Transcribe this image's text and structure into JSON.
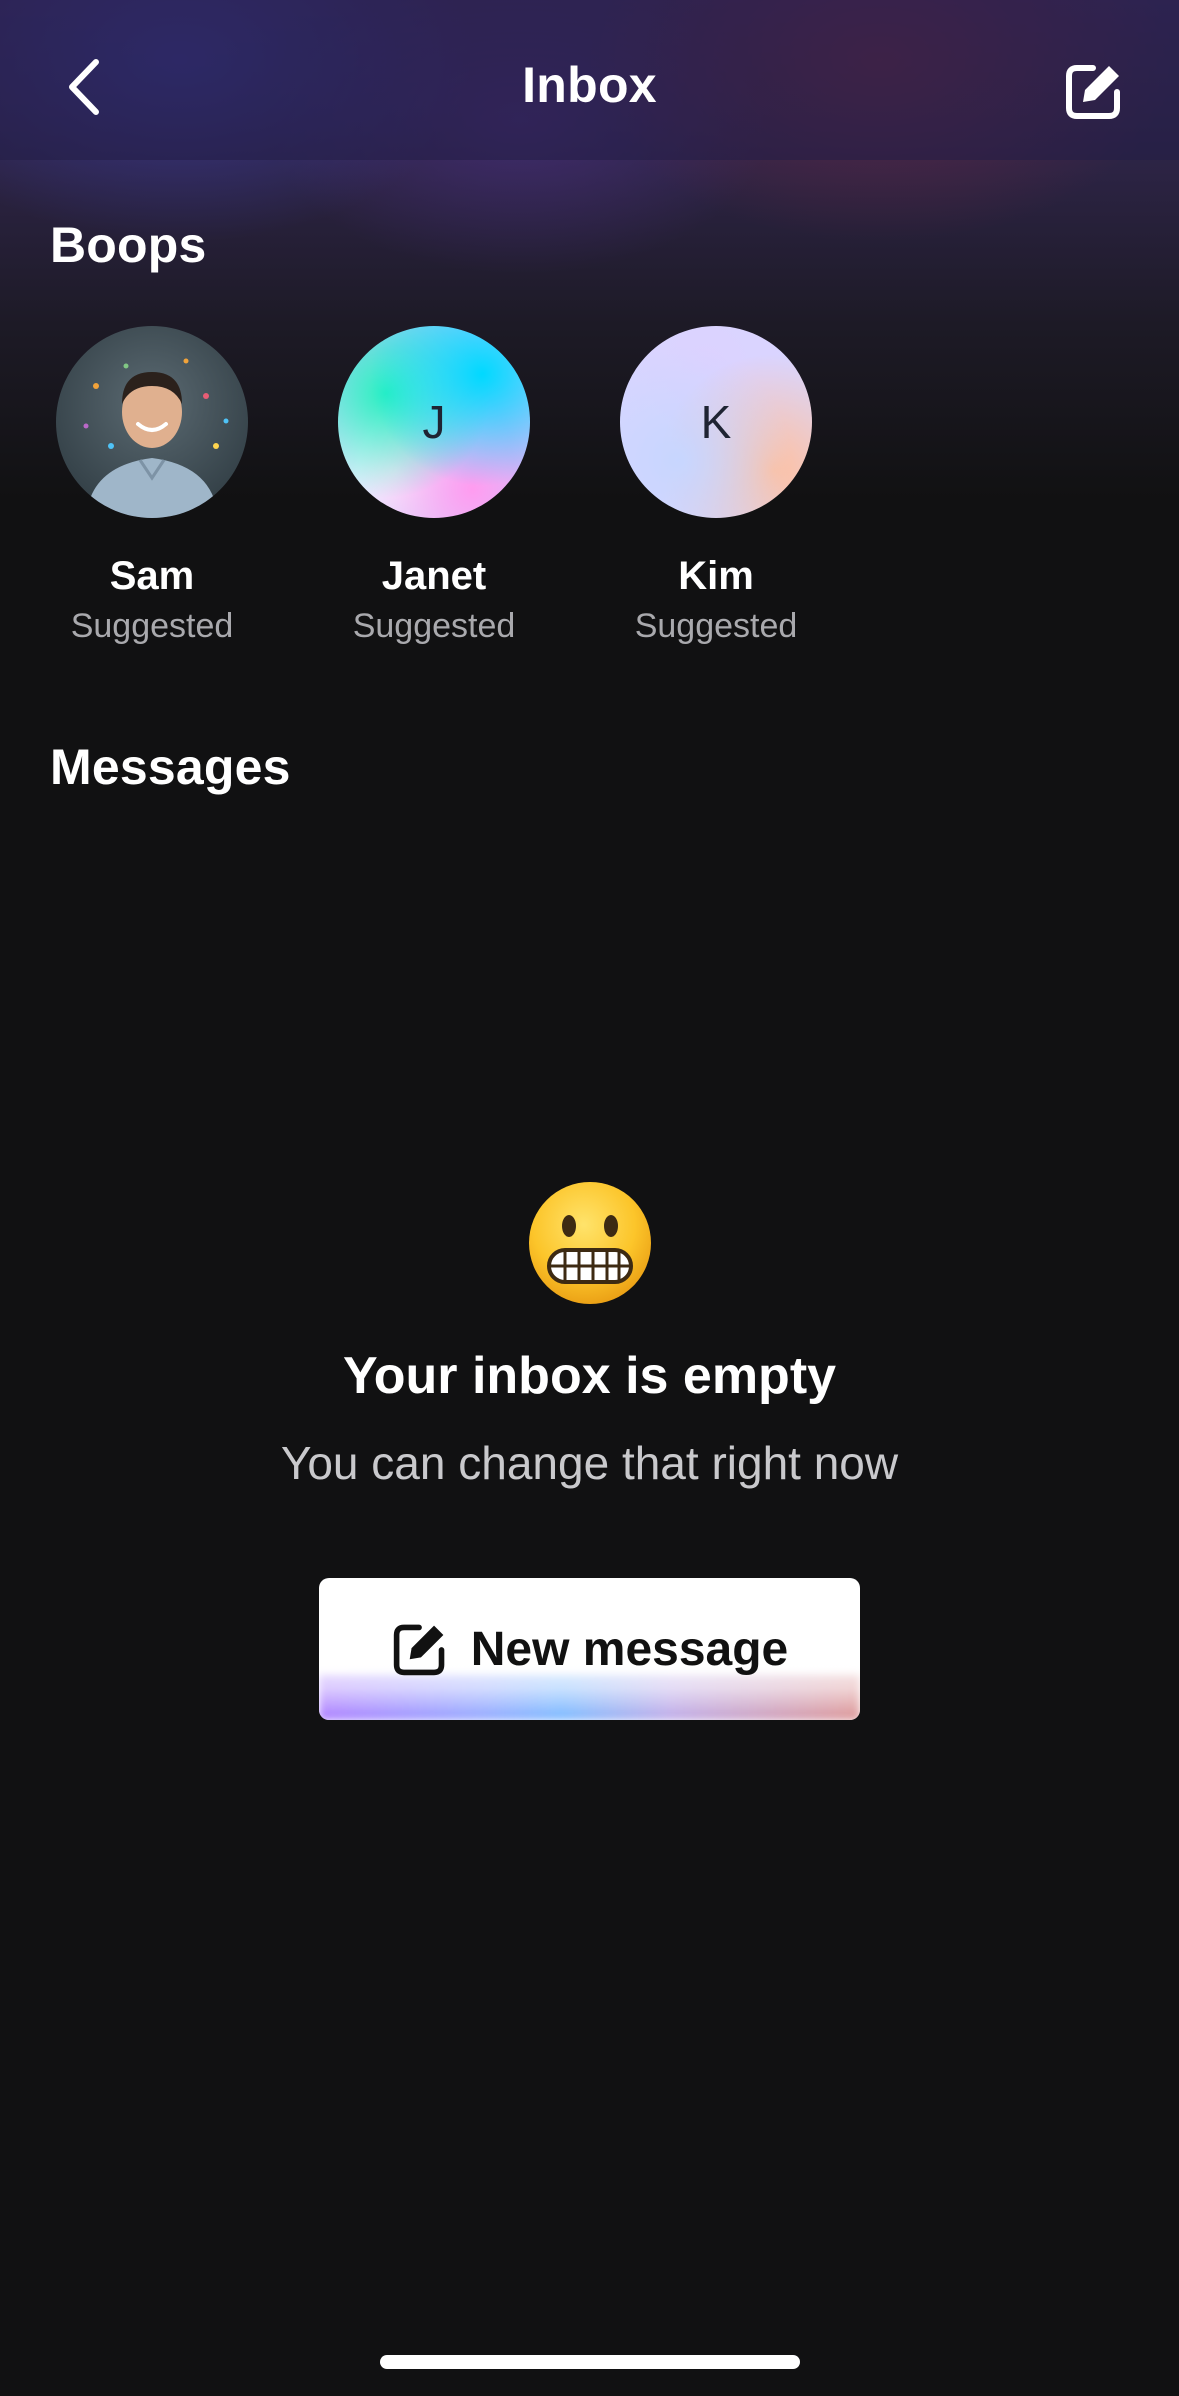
{
  "header": {
    "title": "Inbox",
    "back_icon": "chevron-left-icon",
    "compose_icon": "compose-icon"
  },
  "boops": {
    "title": "Boops",
    "items": [
      {
        "name": "Sam",
        "status": "Suggested",
        "avatar": "photo"
      },
      {
        "name": "Janet",
        "status": "Suggested",
        "avatar": "J"
      },
      {
        "name": "Kim",
        "status": "Suggested",
        "avatar": "K"
      }
    ]
  },
  "messages": {
    "title": "Messages"
  },
  "empty_state": {
    "emoji": "grimacing-face-icon",
    "title": "Your inbox is empty",
    "subtitle": "You can change that right now"
  },
  "new_message_button": {
    "label": "New message",
    "icon": "compose-icon"
  },
  "colors": {
    "background": "#111112",
    "header_tint": "#2f2a5c",
    "muted_text": "#a9a9ad",
    "button_bg": "#ffffff"
  }
}
